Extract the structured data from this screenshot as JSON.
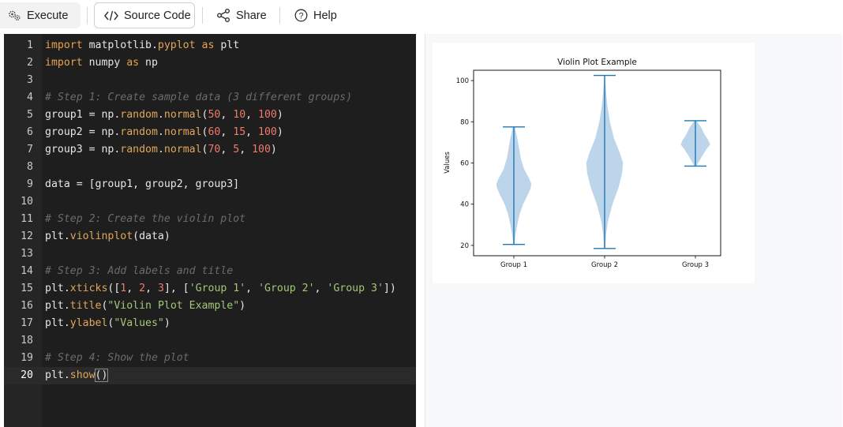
{
  "toolbar": {
    "execute_label": "Execute",
    "source_label": "Source Code",
    "share_label": "Share",
    "help_label": "Help"
  },
  "editor": {
    "active_line": 20,
    "lines": [
      {
        "n": "1",
        "tokens": [
          [
            "kw",
            "import"
          ],
          [
            "p",
            " matplotlib."
          ],
          [
            "fn",
            "pyplot"
          ],
          [
            "p",
            " "
          ],
          [
            "kw",
            "as"
          ],
          [
            "p",
            " plt"
          ]
        ]
      },
      {
        "n": "2",
        "tokens": [
          [
            "kw",
            "import"
          ],
          [
            "p",
            " numpy "
          ],
          [
            "kw",
            "as"
          ],
          [
            "p",
            " np"
          ]
        ]
      },
      {
        "n": "3",
        "tokens": []
      },
      {
        "n": "4",
        "tokens": [
          [
            "cm",
            "# Step 1: Create sample data (3 different groups)"
          ]
        ]
      },
      {
        "n": "5",
        "tokens": [
          [
            "p",
            "group1 = np."
          ],
          [
            "fn",
            "random"
          ],
          [
            "p",
            "."
          ],
          [
            "fn",
            "normal"
          ],
          [
            "p",
            "("
          ],
          [
            "num",
            "50"
          ],
          [
            "p",
            ", "
          ],
          [
            "num",
            "10"
          ],
          [
            "p",
            ", "
          ],
          [
            "num",
            "100"
          ],
          [
            "p",
            ")"
          ]
        ]
      },
      {
        "n": "6",
        "tokens": [
          [
            "p",
            "group2 = np."
          ],
          [
            "fn",
            "random"
          ],
          [
            "p",
            "."
          ],
          [
            "fn",
            "normal"
          ],
          [
            "p",
            "("
          ],
          [
            "num",
            "60"
          ],
          [
            "p",
            ", "
          ],
          [
            "num",
            "15"
          ],
          [
            "p",
            ", "
          ],
          [
            "num",
            "100"
          ],
          [
            "p",
            ")"
          ]
        ]
      },
      {
        "n": "7",
        "tokens": [
          [
            "p",
            "group3 = np."
          ],
          [
            "fn",
            "random"
          ],
          [
            "p",
            "."
          ],
          [
            "fn",
            "normal"
          ],
          [
            "p",
            "("
          ],
          [
            "num",
            "70"
          ],
          [
            "p",
            ", "
          ],
          [
            "num",
            "5"
          ],
          [
            "p",
            ", "
          ],
          [
            "num",
            "100"
          ],
          [
            "p",
            ")"
          ]
        ]
      },
      {
        "n": "8",
        "tokens": []
      },
      {
        "n": "9",
        "tokens": [
          [
            "p",
            "data = [group1, group2, group3]"
          ]
        ]
      },
      {
        "n": "10",
        "tokens": []
      },
      {
        "n": "11",
        "tokens": [
          [
            "cm",
            "# Step 2: Create the violin plot"
          ]
        ]
      },
      {
        "n": "12",
        "tokens": [
          [
            "p",
            "plt."
          ],
          [
            "fn",
            "violinplot"
          ],
          [
            "p",
            "(data)"
          ]
        ]
      },
      {
        "n": "13",
        "tokens": []
      },
      {
        "n": "14",
        "tokens": [
          [
            "cm",
            "# Step 3: Add labels and title"
          ]
        ]
      },
      {
        "n": "15",
        "tokens": [
          [
            "p",
            "plt."
          ],
          [
            "fn",
            "xticks"
          ],
          [
            "p",
            "(["
          ],
          [
            "num",
            "1"
          ],
          [
            "p",
            ", "
          ],
          [
            "num",
            "2"
          ],
          [
            "p",
            ", "
          ],
          [
            "num",
            "3"
          ],
          [
            "p",
            "], ["
          ],
          [
            "str",
            "'Group 1'"
          ],
          [
            "p",
            ", "
          ],
          [
            "str",
            "'Group 2'"
          ],
          [
            "p",
            ", "
          ],
          [
            "str",
            "'Group 3'"
          ],
          [
            "p",
            "])"
          ]
        ]
      },
      {
        "n": "16",
        "tokens": [
          [
            "p",
            "plt."
          ],
          [
            "fn",
            "title"
          ],
          [
            "p",
            "("
          ],
          [
            "str",
            "\"Violin Plot Example\""
          ],
          [
            "p",
            ")"
          ]
        ]
      },
      {
        "n": "17",
        "tokens": [
          [
            "p",
            "plt."
          ],
          [
            "fn",
            "ylabel"
          ],
          [
            "p",
            "("
          ],
          [
            "str",
            "\"Values\""
          ],
          [
            "p",
            ")"
          ]
        ]
      },
      {
        "n": "18",
        "tokens": []
      },
      {
        "n": "19",
        "tokens": [
          [
            "cm",
            "# Step 4: Show the plot"
          ]
        ]
      },
      {
        "n": "20",
        "tokens": [
          [
            "p",
            "plt."
          ],
          [
            "fn",
            "show"
          ],
          [
            "hl",
            "()"
          ]
        ]
      }
    ]
  },
  "colors": {
    "violin_fill": "#b9d3ea",
    "violin_line": "#1f77b4"
  },
  "chart_data": {
    "type": "violin",
    "title": "Violin Plot Example",
    "ylabel": "Values",
    "xlabel": "",
    "categories": [
      "Group 1",
      "Group 2",
      "Group 3"
    ],
    "ylim": [
      15,
      105
    ],
    "yticks": [
      20,
      40,
      60,
      80,
      100
    ],
    "series": [
      {
        "min": 20.5,
        "max": 77.5,
        "profile": [
          [
            20.5,
            0.02
          ],
          [
            25,
            0.08
          ],
          [
            30,
            0.18
          ],
          [
            35,
            0.3
          ],
          [
            40,
            0.5
          ],
          [
            45,
            0.78
          ],
          [
            48,
            0.92
          ],
          [
            50,
            0.95
          ],
          [
            53,
            0.8
          ],
          [
            57,
            0.55
          ],
          [
            62,
            0.38
          ],
          [
            67,
            0.28
          ],
          [
            72,
            0.18
          ],
          [
            77.5,
            0.04
          ]
        ]
      },
      {
        "min": 18.5,
        "max": 102.5,
        "profile": [
          [
            18.5,
            0.02
          ],
          [
            25,
            0.06
          ],
          [
            32,
            0.18
          ],
          [
            40,
            0.42
          ],
          [
            48,
            0.75
          ],
          [
            55,
            0.95
          ],
          [
            60,
            1.0
          ],
          [
            65,
            0.82
          ],
          [
            72,
            0.5
          ],
          [
            80,
            0.28
          ],
          [
            88,
            0.14
          ],
          [
            95,
            0.06
          ],
          [
            102.5,
            0.01
          ]
        ]
      },
      {
        "min": 58.5,
        "max": 80.5,
        "profile": [
          [
            58.5,
            0.05
          ],
          [
            61,
            0.2
          ],
          [
            64,
            0.4
          ],
          [
            67,
            0.62
          ],
          [
            69,
            0.8
          ],
          [
            71,
            0.7
          ],
          [
            74,
            0.48
          ],
          [
            77,
            0.32
          ],
          [
            80.5,
            0.05
          ]
        ]
      }
    ]
  }
}
